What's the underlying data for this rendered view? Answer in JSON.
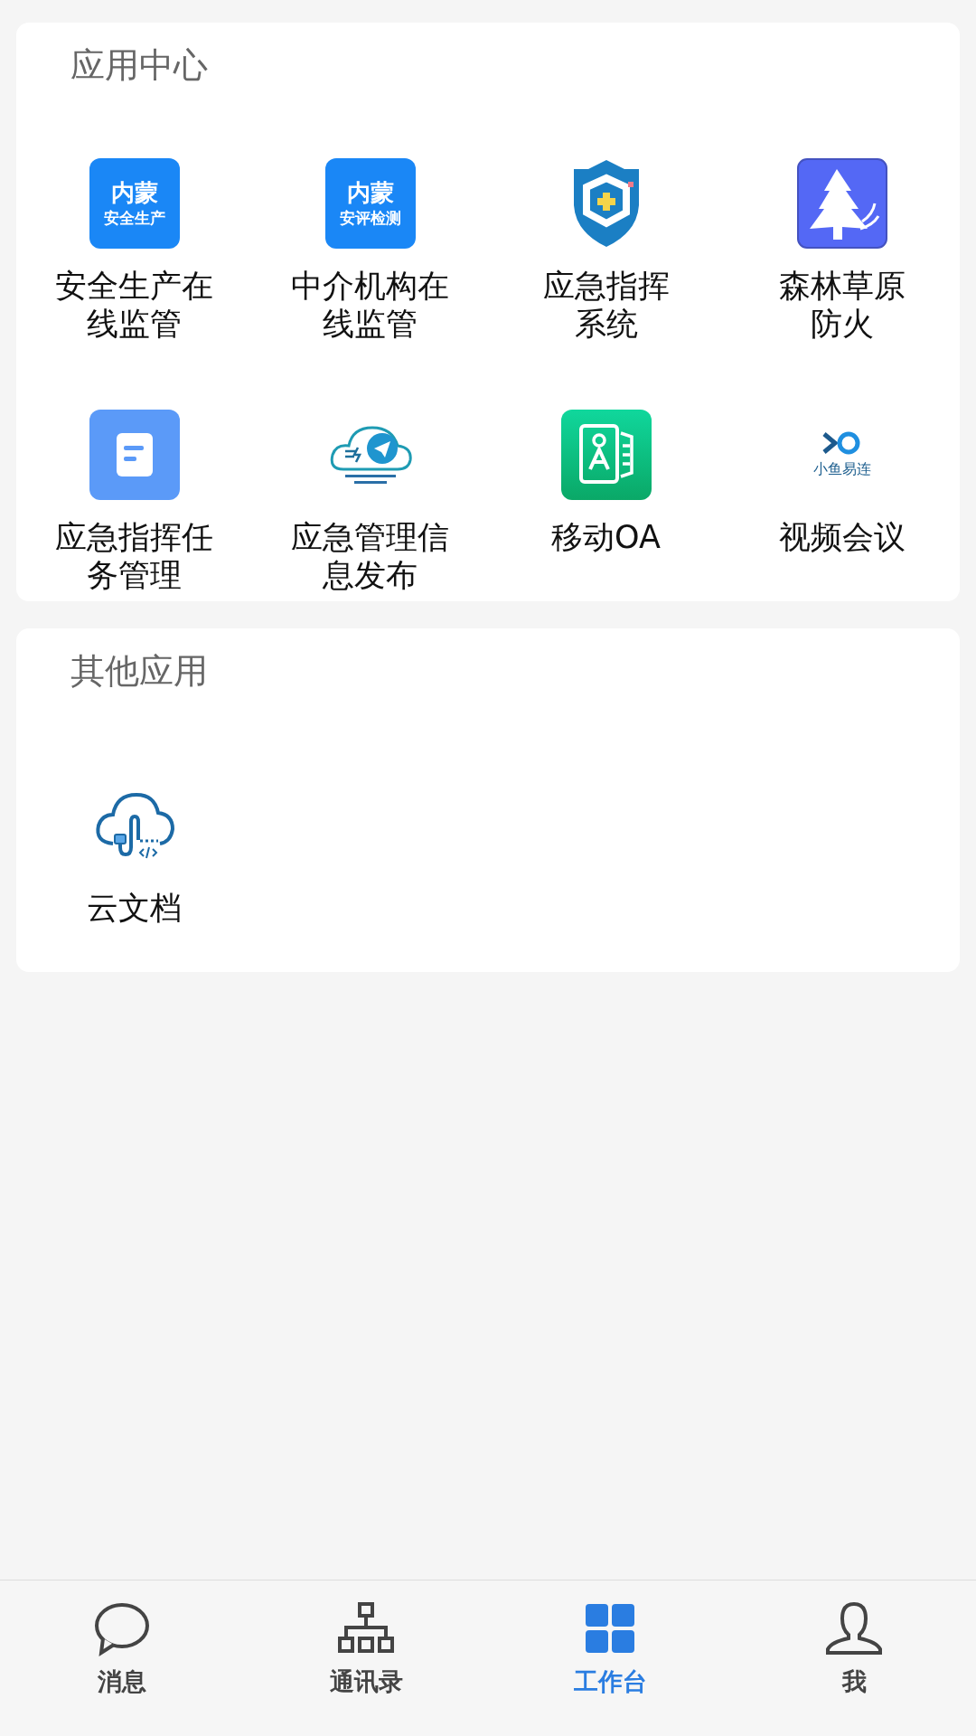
{
  "sections": [
    {
      "title": "应用中心",
      "apps": [
        {
          "label": "安全生产在线监管",
          "icon": {
            "kind": "text-tile",
            "line_1": "内蒙",
            "line_2": "安全生产"
          }
        },
        {
          "label": "中介机构在线监管",
          "icon": {
            "kind": "text-tile",
            "line_1": "内蒙",
            "line_2": "安评检测"
          }
        },
        {
          "label_lines": [
            "应急指挥",
            "系统"
          ],
          "icon": {
            "kind": "shield"
          }
        },
        {
          "label_lines": [
            "森林草原",
            "防火"
          ],
          "icon": {
            "kind": "tree"
          }
        },
        {
          "label": "应急指挥任务管理",
          "icon": {
            "kind": "document"
          }
        },
        {
          "label": "应急管理信息发布",
          "icon": {
            "kind": "paper-plane"
          }
        },
        {
          "label": "移动OA",
          "icon": {
            "kind": "contact-card"
          }
        },
        {
          "label": "视频会议",
          "icon": {
            "kind": "logo-text",
            "line_1": "小鱼易连"
          }
        }
      ]
    },
    {
      "title": "其他应用",
      "apps": [
        {
          "label": "云文档",
          "icon": {
            "kind": "cloud"
          }
        }
      ]
    }
  ],
  "tabs": [
    {
      "label": "消息",
      "kind": "chat",
      "selected": false
    },
    {
      "label": "通讯录",
      "kind": "org",
      "selected": false
    },
    {
      "label": "工作台",
      "kind": "grid",
      "selected": true
    },
    {
      "label": "我",
      "kind": "person",
      "selected": false
    }
  ]
}
